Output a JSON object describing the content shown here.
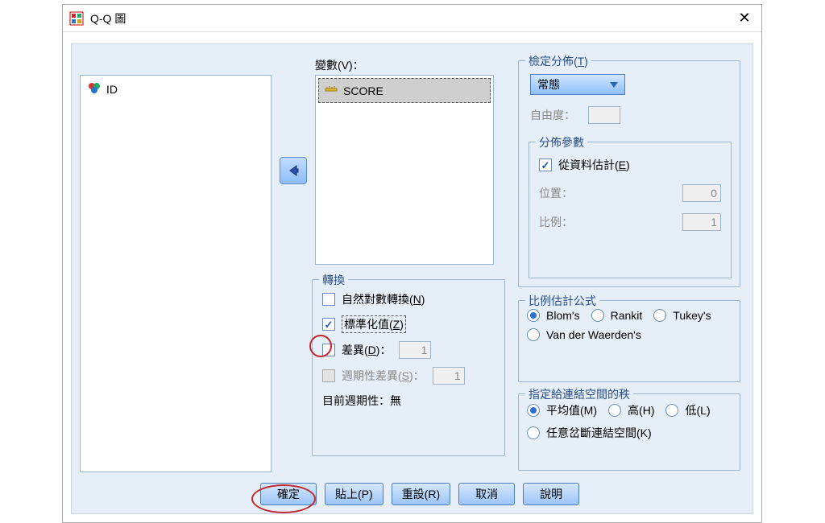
{
  "window": {
    "title": "Q-Q 圖"
  },
  "labels": {
    "variables": "變數(V)：",
    "transform_legend": "轉換",
    "nat_log": "自然對數轉換(N)",
    "standardize": "標準化值(Z)",
    "difference": "差異(D)：",
    "seasonal": "週期性差異(S)：",
    "period_label": "目前週期性：",
    "period_value": "無",
    "dist_legend": "檢定分佈",
    "dist_mn": "T",
    "df_label": "自由度：",
    "params_legend": "分佈參數",
    "from_data": "從資料估計(E)",
    "location": "位置：",
    "scale": "比例：",
    "prop_legend": "比例估計公式",
    "blom": "Blom's",
    "rankit": "Rankit",
    "tukey": "Tukey's",
    "vdw": "Van der Waerden's",
    "ties_legend": "指定給連結空間的秩",
    "mean": "平均值(M)",
    "high": "高(H)",
    "low": "低(L)",
    "break": "任意岔斷連結空間(K)"
  },
  "values": {
    "diff": "1",
    "seasonal": "1",
    "location": "0",
    "scale": "1",
    "df": ""
  },
  "source_items": [
    "ID"
  ],
  "target_items": [
    "SCORE"
  ],
  "distribution": "常態",
  "buttons": {
    "ok": "確定",
    "paste": "貼上(P)",
    "reset": "重設(R)",
    "cancel": "取消",
    "help": "說明"
  }
}
